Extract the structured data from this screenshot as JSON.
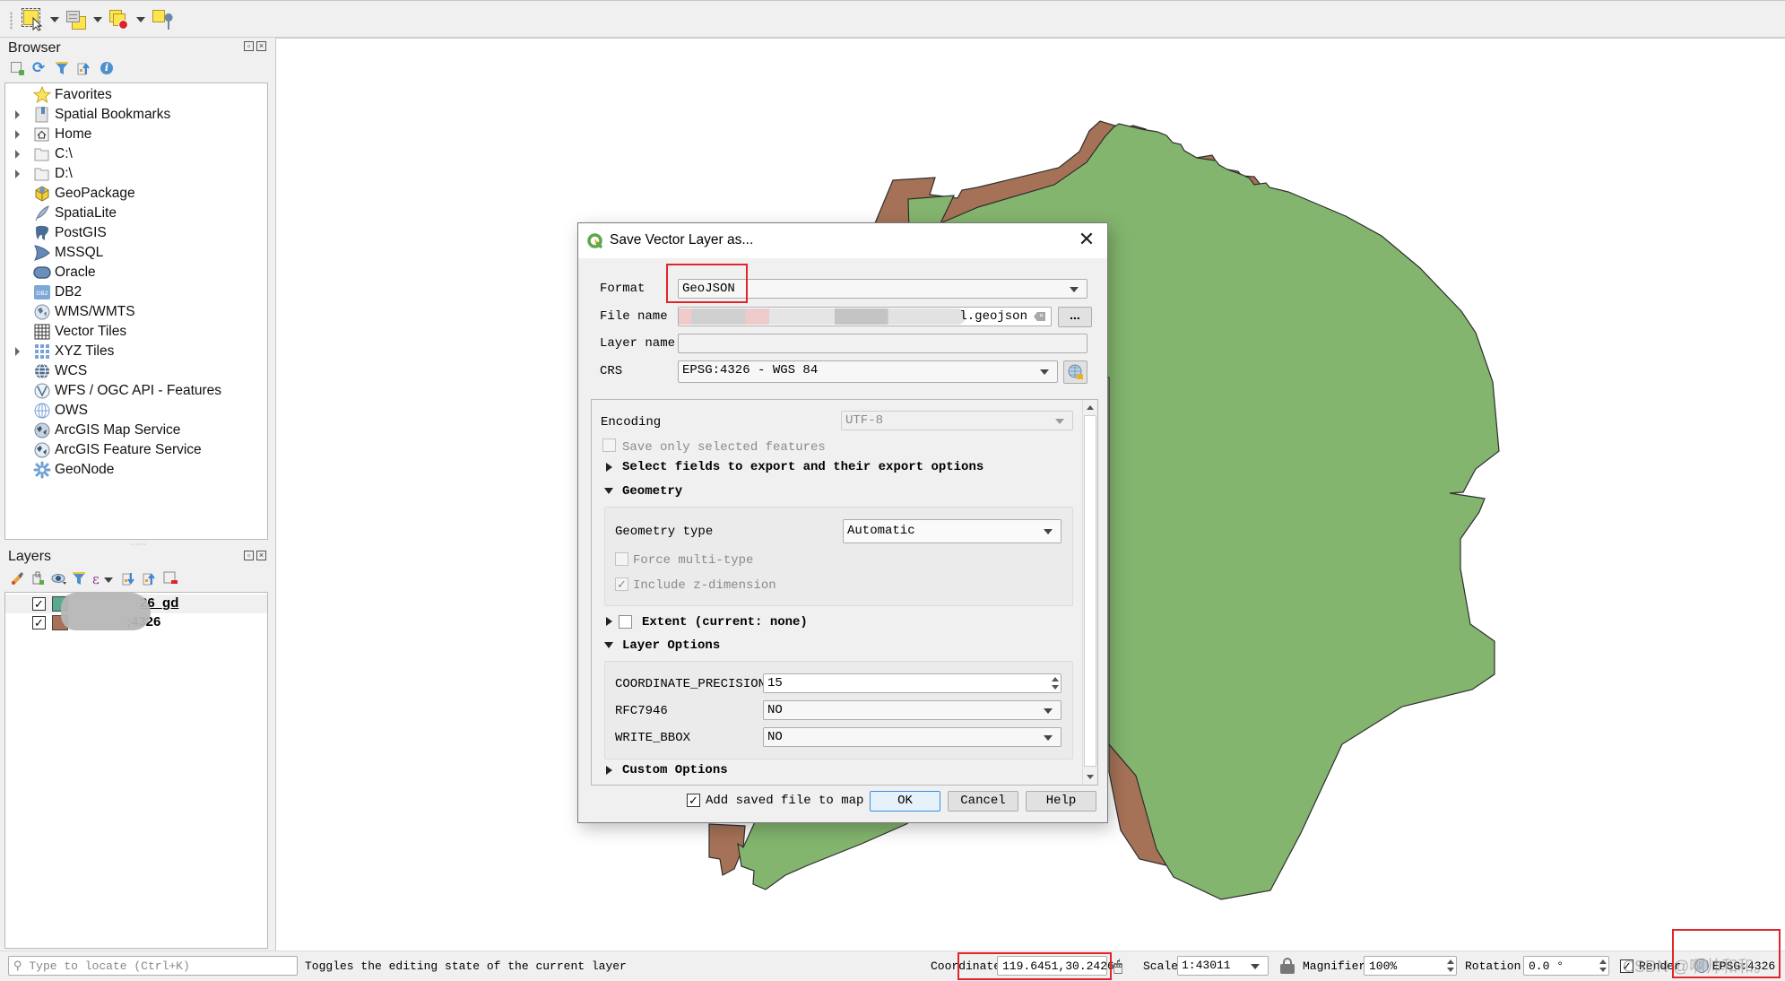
{
  "toolbar": {
    "buttons": [
      {
        "name": "select-features-icon",
        "has_dropdown": true
      },
      {
        "name": "select-by-attribute-icon",
        "has_dropdown": true
      },
      {
        "name": "deselect-features-icon",
        "has_dropdown": true
      },
      {
        "name": "select-by-location-icon",
        "has_dropdown": false
      }
    ]
  },
  "browser": {
    "title": "Browser",
    "tools": [
      "add-selected-layers-icon",
      "refresh-icon",
      "filter-icon",
      "collapse-all-icon",
      "properties-info-icon"
    ],
    "items": [
      {
        "label": "Favorites",
        "icon": "star-icon",
        "expandable": false
      },
      {
        "label": "Spatial Bookmarks",
        "icon": "bookmark-icon",
        "expandable": true
      },
      {
        "label": "Home",
        "icon": "home-folder-icon",
        "expandable": true
      },
      {
        "label": "C:\\",
        "icon": "folder-icon",
        "expandable": true
      },
      {
        "label": "D:\\",
        "icon": "folder-icon",
        "expandable": true
      },
      {
        "label": "GeoPackage",
        "icon": "geopackage-icon",
        "expandable": false
      },
      {
        "label": "SpatiaLite",
        "icon": "feather-icon",
        "expandable": false
      },
      {
        "label": "PostGIS",
        "icon": "elephant-icon",
        "expandable": false
      },
      {
        "label": "MSSQL",
        "icon": "mssql-icon",
        "expandable": false
      },
      {
        "label": "Oracle",
        "icon": "oracle-icon",
        "expandable": false
      },
      {
        "label": "DB2",
        "icon": "db2-icon",
        "expandable": false
      },
      {
        "label": "WMS/WMTS",
        "icon": "globe-icon",
        "expandable": false
      },
      {
        "label": "Vector Tiles",
        "icon": "grid-icon",
        "expandable": false
      },
      {
        "label": "XYZ Tiles",
        "icon": "tiles-icon",
        "expandable": true
      },
      {
        "label": "WCS",
        "icon": "wcs-globe-icon",
        "expandable": false
      },
      {
        "label": "WFS / OGC API - Features",
        "icon": "wfs-globe-icon",
        "expandable": false
      },
      {
        "label": "OWS",
        "icon": "ows-globe-icon",
        "expandable": false
      },
      {
        "label": "ArcGIS Map Service",
        "icon": "arcgis-globe-icon",
        "expandable": false
      },
      {
        "label": "ArcGIS Feature Service",
        "icon": "arcgis-feature-globe-icon",
        "expandable": false
      },
      {
        "label": "GeoNode",
        "icon": "geonode-icon",
        "expandable": false
      }
    ]
  },
  "layers": {
    "title": "Layers",
    "tools": [
      "style-icon",
      "add-group-icon",
      "visibility-icon",
      "filter-legend-icon",
      "expression-filter-icon",
      "expand-all-icon",
      "collapse-all-icon",
      "remove-layer-icon"
    ],
    "items": [
      {
        "label": "26_gd",
        "checked": true,
        "color": "#5aa890",
        "active": true
      },
      {
        "label": ";4326",
        "checked": true,
        "color": "#a87058",
        "active": false
      }
    ]
  },
  "map": {
    "fill_green": "#83b56e",
    "fill_brown": "#a57257",
    "stroke": "#2e2e2e"
  },
  "dialog": {
    "title": "Save Vector Layer as...",
    "format_label": "Format",
    "format_value": "GeoJSON",
    "filename_label": "File name",
    "filename_value": "l.geojson",
    "browse_label": "...",
    "layername_label": "Layer name",
    "layername_value": "",
    "crs_label": "CRS",
    "crs_value": "EPSG:4326 - WGS 84",
    "encoding_label": "Encoding",
    "encoding_value": "UTF-8",
    "save_selected_label": "Save only selected features",
    "save_selected_checked": false,
    "select_fields_label": "Select fields to export and their export options",
    "geometry_section": "Geometry",
    "geometry_type_label": "Geometry type",
    "geometry_type_value": "Automatic",
    "force_multi_label": "Force multi-type",
    "force_multi_checked": false,
    "include_z_label": "Include z-dimension",
    "include_z_checked": true,
    "extent_label": "Extent (current: none)",
    "extent_checked": false,
    "layer_options_section": "Layer Options",
    "layer_options": [
      {
        "key": "COORDINATE_PRECISION",
        "value": "15",
        "type": "spinbox"
      },
      {
        "key": "RFC7946",
        "value": "NO",
        "type": "combo"
      },
      {
        "key": "WRITE_BBOX",
        "value": "NO",
        "type": "combo"
      }
    ],
    "custom_options_label": "Custom Options",
    "add_to_map_label": "Add saved file to map",
    "add_to_map_checked": true,
    "ok_label": "OK",
    "cancel_label": "Cancel",
    "help_label": "Help"
  },
  "statusbar": {
    "locate_placeholder": "Type to locate (Ctrl+K)",
    "message": "Toggles the editing state of the current layer",
    "coordinate_label": "Coordinate",
    "coordinate_value": "119.6451,30.2426",
    "scale_label": "Scale",
    "scale_value": "1:43011",
    "magnifier_label": "Magnifier",
    "magnifier_value": "100%",
    "rotation_label": "Rotation",
    "rotation_value": "0.0 °",
    "render_label": "Render",
    "render_checked": true,
    "crs_value": "EPSG:4326",
    "watermark": "CSDN @啊帅和和。"
  }
}
